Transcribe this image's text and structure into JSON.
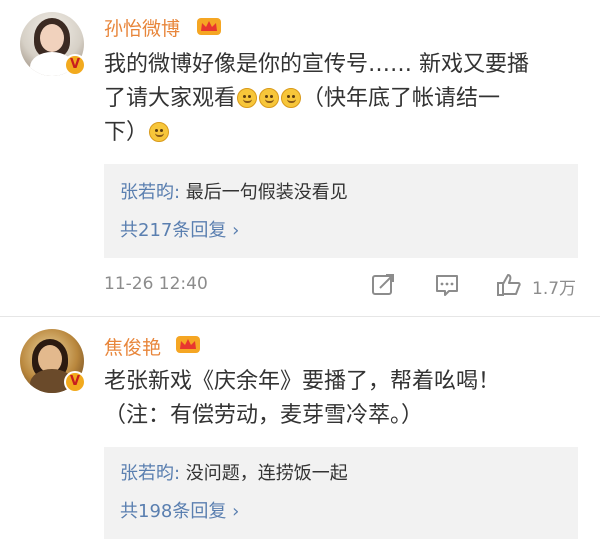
{
  "comments": [
    {
      "username": "孙怡微博",
      "text_line1": "我的微博好像是你的宣传号…… 新戏又要播",
      "text_line2a": "了请大家观看",
      "text_line2b": "（快年底了帐请结一",
      "text_line3": "下）",
      "reply": {
        "author": "张若昀:",
        "text": " 最后一句假装没看见",
        "count_label": "共217条回复 ›"
      },
      "timestamp": "11-26 12:40",
      "like_count": "1.7万"
    },
    {
      "username": "焦俊艳",
      "text_line1": "老张新戏《庆余年》要播了，帮着吆喝！",
      "text_line2": "（注：有偿劳动，麦芽雪冷萃。）",
      "reply": {
        "author": "张若昀:",
        "text": " 没问题，连捞饭一起",
        "count_label": "共198条回复 ›"
      }
    }
  ],
  "colors": {
    "username": "#e8863b",
    "link_blue": "#5a7fb0",
    "reply_bg": "#f2f2f2",
    "meta_gray": "#8c8c8c"
  },
  "icons": [
    "verified-v-icon",
    "crown-icon",
    "smile-emoji-icon",
    "repost-icon",
    "comment-icon",
    "like-icon",
    "chevron-right-icon"
  ]
}
